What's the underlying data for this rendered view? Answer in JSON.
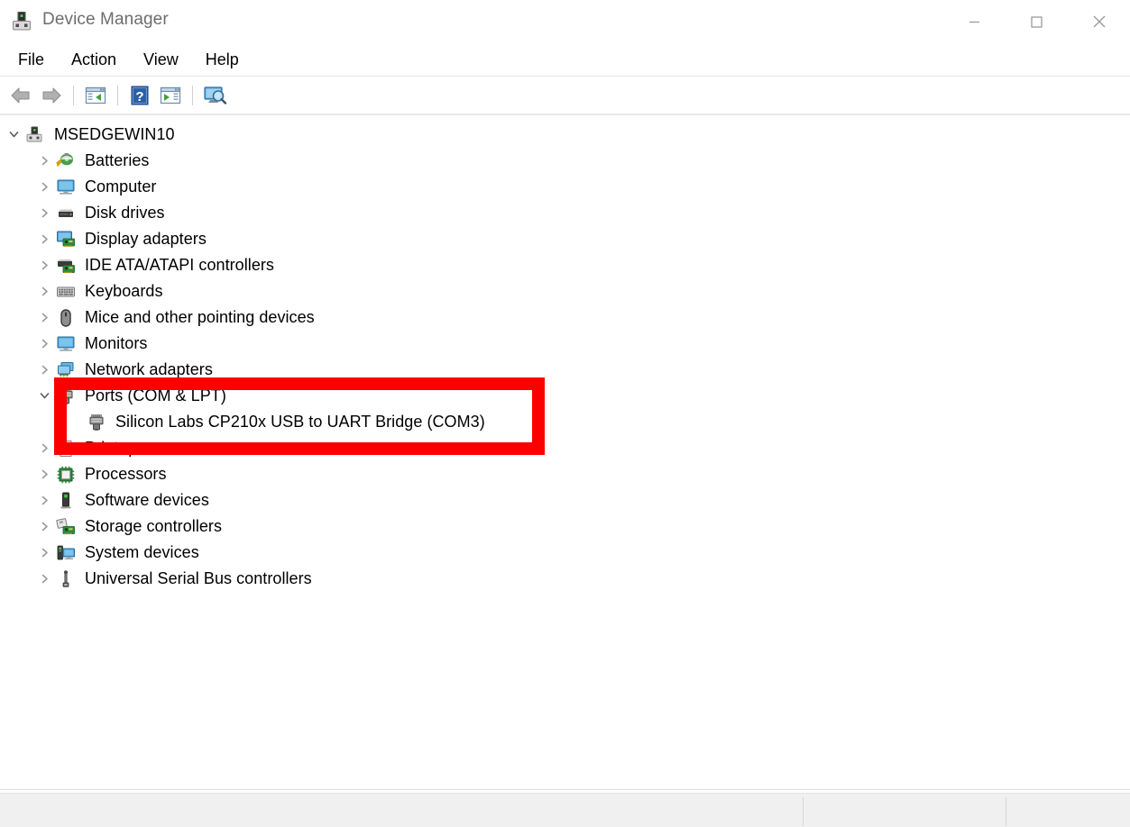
{
  "window": {
    "title": "Device Manager",
    "icon": "device-manager-icon",
    "controls": {
      "minimize": "—",
      "maximize": "□",
      "close": "✕"
    }
  },
  "menubar": {
    "items": [
      {
        "label": "File"
      },
      {
        "label": "Action"
      },
      {
        "label": "View"
      },
      {
        "label": "Help"
      }
    ]
  },
  "toolbar": {
    "buttons": [
      {
        "name": "back-icon",
        "title": "Back"
      },
      {
        "name": "forward-icon",
        "title": "Forward"
      },
      {
        "name": "properties-icon",
        "title": "Properties"
      },
      {
        "name": "help-icon",
        "title": "Help"
      },
      {
        "name": "update-driver-icon",
        "title": "Update driver"
      },
      {
        "name": "scan-hardware-icon",
        "title": "Scan for hardware changes"
      }
    ]
  },
  "tree": {
    "root": {
      "label": "MSEDGEWIN10",
      "icon": "computer-root-icon",
      "expanded": true
    },
    "nodes": [
      {
        "label": "Batteries",
        "icon": "battery-icon",
        "expanded": false,
        "level": 1
      },
      {
        "label": "Computer",
        "icon": "monitor-icon",
        "expanded": false,
        "level": 1
      },
      {
        "label": "Disk drives",
        "icon": "disk-icon",
        "expanded": false,
        "level": 1
      },
      {
        "label": "Display adapters",
        "icon": "display-adapter-icon",
        "expanded": false,
        "level": 1
      },
      {
        "label": "IDE ATA/ATAPI controllers",
        "icon": "ide-controller-icon",
        "expanded": false,
        "level": 1
      },
      {
        "label": "Keyboards",
        "icon": "keyboard-icon",
        "expanded": false,
        "level": 1
      },
      {
        "label": "Mice and other pointing devices",
        "icon": "mouse-icon",
        "expanded": false,
        "level": 1
      },
      {
        "label": "Monitors",
        "icon": "monitor-icon",
        "expanded": false,
        "level": 1
      },
      {
        "label": "Network adapters",
        "icon": "network-adapter-icon",
        "expanded": false,
        "level": 1
      },
      {
        "label": "Ports (COM & LPT)",
        "icon": "port-icon",
        "expanded": true,
        "level": 1
      },
      {
        "label": "Silicon Labs CP210x USB to UART Bridge (COM3)",
        "icon": "port-icon",
        "expanded": null,
        "level": 2
      },
      {
        "label": "Print queues",
        "icon": "print-queue-icon",
        "expanded": false,
        "level": 1
      },
      {
        "label": "Processors",
        "icon": "processor-icon",
        "expanded": false,
        "level": 1
      },
      {
        "label": "Software devices",
        "icon": "software-device-icon",
        "expanded": false,
        "level": 1
      },
      {
        "label": "Storage controllers",
        "icon": "storage-controller-icon",
        "expanded": false,
        "level": 1
      },
      {
        "label": "System devices",
        "icon": "system-device-icon",
        "expanded": false,
        "level": 1
      },
      {
        "label": "Universal Serial Bus controllers",
        "icon": "usb-controller-icon",
        "expanded": false,
        "level": 1
      }
    ]
  },
  "annotation": {
    "color": "#fc0000",
    "target_labels": [
      "Ports (COM & LPT)",
      "Silicon Labs CP210x USB to UART Bridge (COM3)"
    ]
  },
  "statusbar": {
    "left_text": "",
    "middle_text": "",
    "right_text": ""
  }
}
